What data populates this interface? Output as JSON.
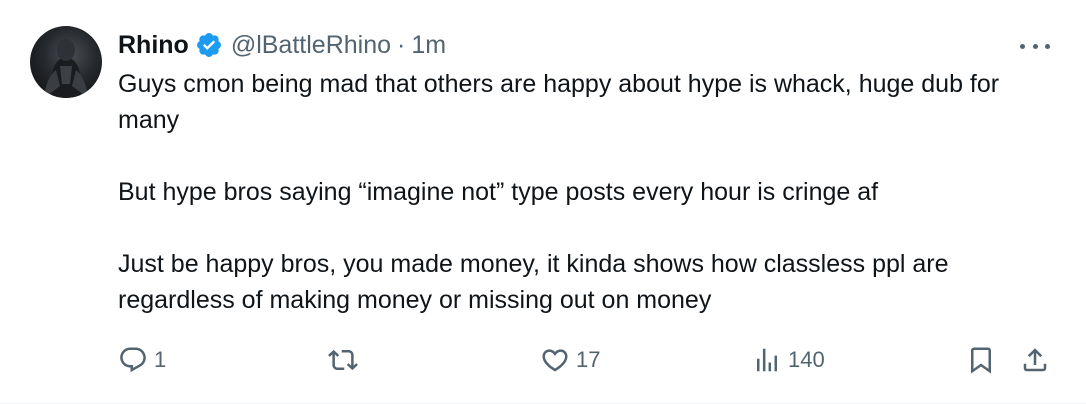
{
  "tweet": {
    "author_name": "Rhino",
    "handle": "@lBattleRhino",
    "separator": "·",
    "time": "1m",
    "body_paragraphs": [
      "Guys cmon being mad that others are happy about hype is whack, huge dub for many",
      "But hype bros saying “imagine not” type posts every hour is cringe af",
      "Just be happy bros, you made money, it kinda shows how classless ppl are regardless of making money or missing out on money"
    ],
    "stats": {
      "replies": "1",
      "reposts": "",
      "likes": "17",
      "views": "140"
    }
  },
  "colors": {
    "text": "#0f1419",
    "muted": "#536471",
    "verified": "#1d9bf0"
  },
  "icons": {
    "verified": "verified-badge-icon",
    "more": "more-dots-icon",
    "reply": "reply-icon",
    "repost": "repost-icon",
    "like": "like-icon",
    "views": "views-icon",
    "bookmark": "bookmark-icon",
    "share": "share-icon"
  }
}
